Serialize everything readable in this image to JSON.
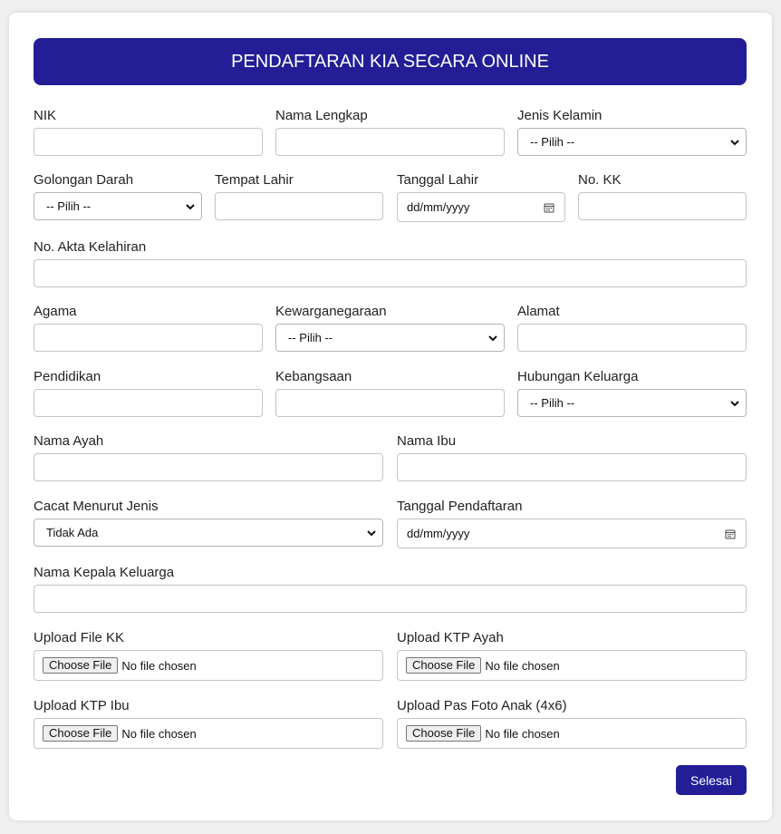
{
  "colors": {
    "accent": "#231e96",
    "border": "#c4c4c4"
  },
  "form": {
    "title": "PENDAFTARAN KIA SECARA ONLINE",
    "nik": {
      "label": "NIK",
      "value": ""
    },
    "nama_lengkap": {
      "label": "Nama Lengkap",
      "value": ""
    },
    "jenis_kelamin": {
      "label": "Jenis Kelamin",
      "selected": "-- Pilih --"
    },
    "golongan_darah": {
      "label": "Golongan Darah",
      "selected": "-- Pilih --"
    },
    "tempat_lahir": {
      "label": "Tempat Lahir",
      "value": ""
    },
    "tanggal_lahir": {
      "label": "Tanggal Lahir",
      "placeholder": "dd/mm/yyyy"
    },
    "no_kk": {
      "label": "No. KK",
      "value": ""
    },
    "no_akta": {
      "label": "No. Akta Kelahiran",
      "value": ""
    },
    "agama": {
      "label": "Agama",
      "value": ""
    },
    "kewarganegaraan": {
      "label": "Kewarganegaraan",
      "selected": "-- Pilih --"
    },
    "alamat": {
      "label": "Alamat",
      "value": ""
    },
    "pendidikan": {
      "label": "Pendidikan",
      "value": ""
    },
    "kebangsaan": {
      "label": "Kebangsaan",
      "value": ""
    },
    "hubungan_keluarga": {
      "label": "Hubungan Keluarga",
      "selected": "-- Pilih --"
    },
    "nama_ayah": {
      "label": "Nama Ayah",
      "value": ""
    },
    "nama_ibu": {
      "label": "Nama Ibu",
      "value": ""
    },
    "cacat_menurut_jenis": {
      "label": "Cacat Menurut Jenis",
      "selected": "Tidak Ada"
    },
    "tanggal_pendaftaran": {
      "label": "Tanggal Pendaftaran",
      "placeholder": "dd/mm/yyyy"
    },
    "nama_kepala_keluarga": {
      "label": "Nama Kepala Keluarga",
      "value": ""
    },
    "upload_kk": {
      "label": "Upload File KK",
      "button": "Choose File",
      "status": "No file chosen"
    },
    "upload_ktp_ayah": {
      "label": "Upload KTP Ayah",
      "button": "Choose File",
      "status": "No file chosen"
    },
    "upload_ktp_ibu": {
      "label": "Upload KTP Ibu",
      "button": "Choose File",
      "status": "No file chosen"
    },
    "upload_pas_foto": {
      "label": "Upload Pas Foto Anak (4x6)",
      "button": "Choose File",
      "status": "No file chosen"
    },
    "submit_label": "Selesai"
  }
}
